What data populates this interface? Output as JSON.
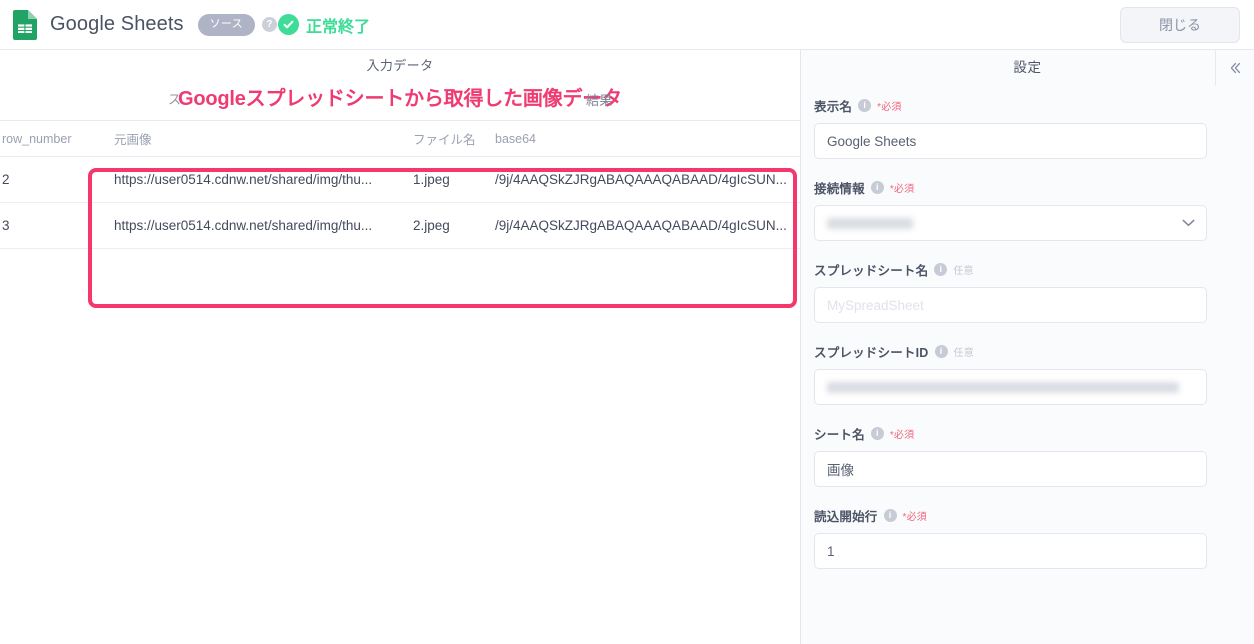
{
  "header": {
    "logo_icon": "google-sheets-logo",
    "title": "Google Sheets",
    "source_badge": "ソース",
    "info_icon": "?",
    "status_icon": "check-circle-icon",
    "status_text": "正常終了",
    "close_label": "閉じる",
    "status_color": "#3ddc97"
  },
  "data_pane": {
    "tab_label": "入力データ",
    "result_left_fragment": "ス",
    "result_label": "結果",
    "annotation": {
      "text": "Googleスプレッドシートから取得した画像データ",
      "color": "#ef3b72",
      "box_color": "#f4376d"
    },
    "table": {
      "columns": [
        "row_number",
        "元画像",
        "ファイル名",
        "base64"
      ],
      "rows": [
        {
          "row_number": "2",
          "image_url": "https://user0514.cdnw.net/shared/img/thu...",
          "file_name": "1.jpeg",
          "base64": "/9j/4AAQSkZJRgABAQAAAQABAAD/4gIcSUN..."
        },
        {
          "row_number": "3",
          "image_url": "https://user0514.cdnw.net/shared/img/thu...",
          "file_name": "2.jpeg",
          "base64": "/9j/4AAQSkZJRgABAQAAAQABAAD/4gIcSUN..."
        }
      ]
    }
  },
  "settings": {
    "title": "設定",
    "collapse_icon": "chevron-double-left-icon",
    "required_tag": "*必須",
    "optional_tag": "任意",
    "info_glyph": "i",
    "fields": {
      "display_name": {
        "label": "表示名",
        "value": "Google Sheets"
      },
      "connection": {
        "label": "接続情報",
        "value": "",
        "chevron": "⌄"
      },
      "spreadsheet_name": {
        "label": "スプレッドシート名",
        "placeholder": "MySpreadSheet"
      },
      "spreadsheet_id": {
        "label": "スプレッドシートID",
        "value": ""
      },
      "sheet_name": {
        "label": "シート名",
        "value": "画像"
      },
      "start_row": {
        "label": "読込開始行",
        "value": "1"
      }
    }
  }
}
